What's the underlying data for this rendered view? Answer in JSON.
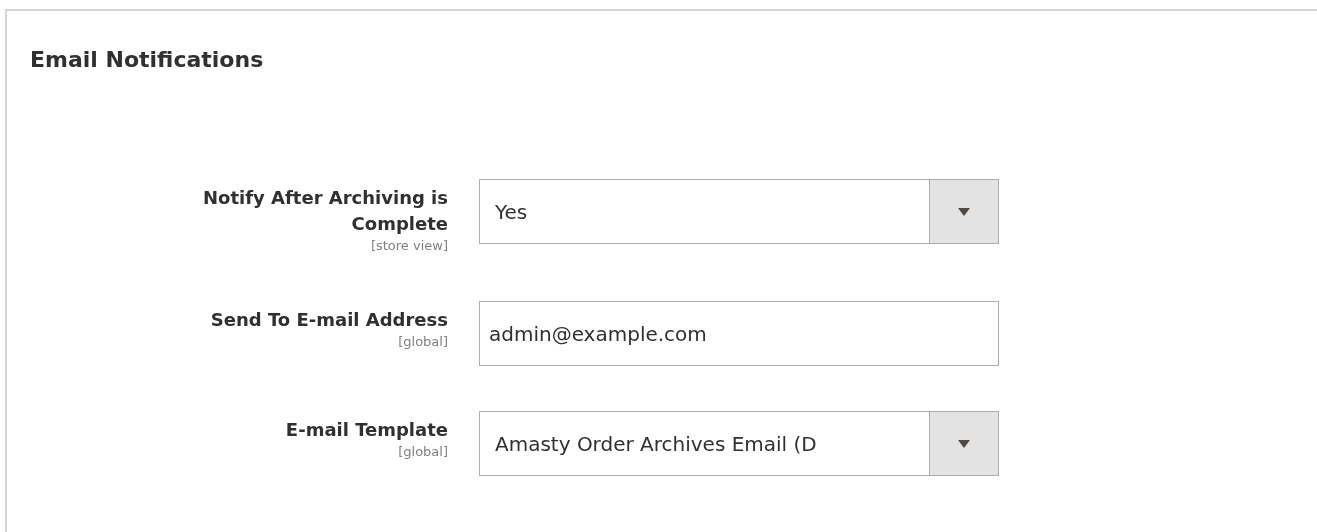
{
  "section": {
    "title": "Email Notifications"
  },
  "fields": [
    {
      "kind": "select",
      "label": "Notify After Archiving is Complete",
      "scope": "[store view]",
      "value": "Yes"
    },
    {
      "kind": "text",
      "label": "Send To E-mail Address",
      "scope": "[global]",
      "value": "admin@example.com"
    },
    {
      "kind": "select",
      "label": "E-mail Template",
      "scope": "[global]",
      "value": "Amasty Order Archives Email (D"
    }
  ]
}
